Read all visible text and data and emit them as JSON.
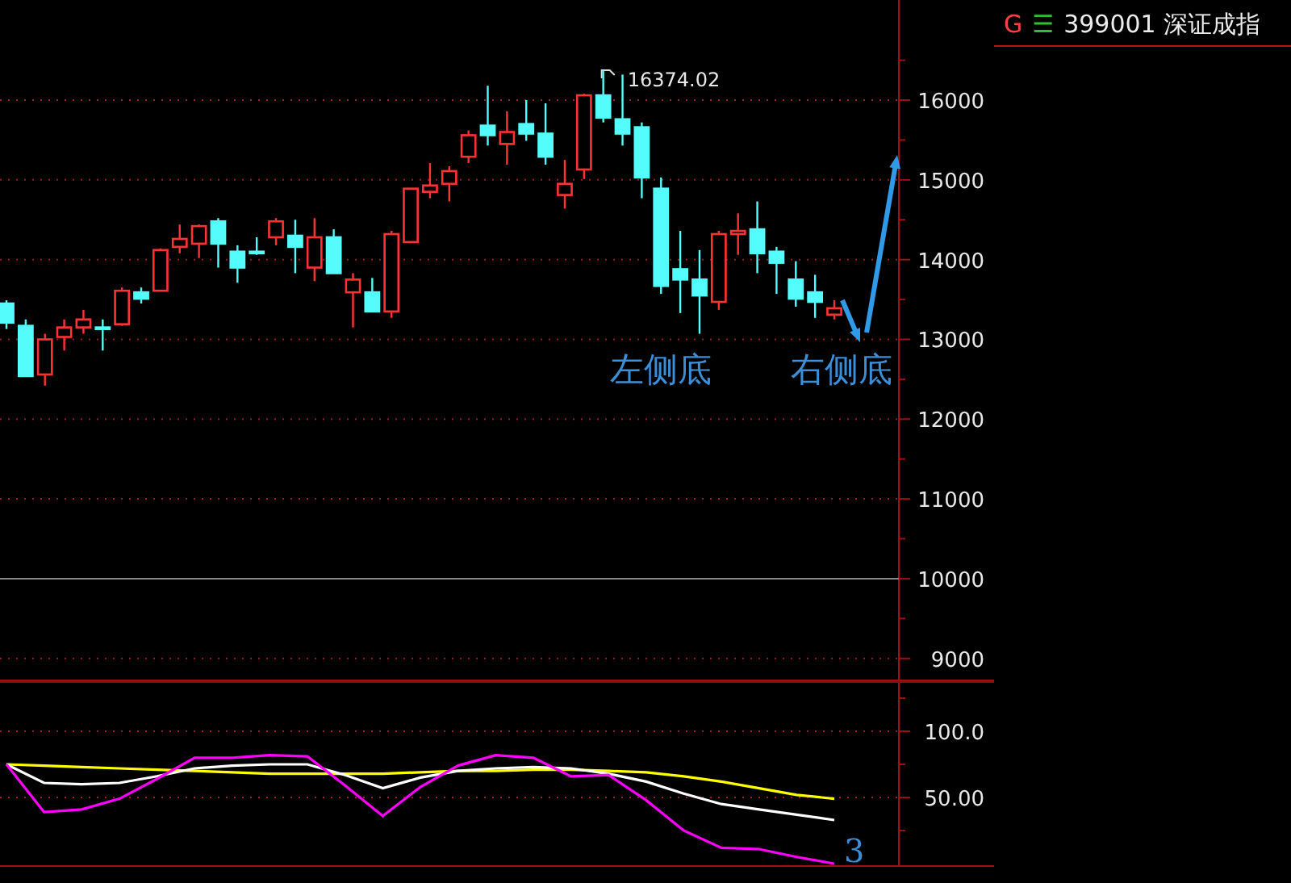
{
  "header": {
    "flag": "G",
    "menu_glyph": "☰",
    "title": "399001 深证成指"
  },
  "price_chart": {
    "chart_data": {
      "type": "candlestick",
      "categories": [
        null,
        null,
        null,
        null,
        null,
        null,
        null,
        null,
        null,
        null,
        null,
        null,
        null,
        null,
        null,
        null,
        null,
        null,
        null,
        null,
        null,
        null,
        null,
        null,
        null,
        null,
        null,
        null,
        null,
        null,
        null,
        null,
        null,
        null,
        null,
        null,
        null,
        null,
        null,
        null,
        null,
        null,
        null,
        null
      ],
      "ylim": [
        8714,
        17255
      ],
      "yticks": [
        9000,
        10000,
        11000,
        12000,
        13000,
        14000,
        15000,
        16000
      ],
      "grid": true,
      "ref_lines": [
        {
          "axis": "y",
          "value": 10000
        }
      ],
      "ohlc": [
        [
          13450,
          13490,
          13130,
          13210
        ],
        [
          13170,
          13250,
          12540,
          12540
        ],
        [
          12560,
          13070,
          12420,
          13000
        ],
        [
          13030,
          13250,
          12860,
          13150
        ],
        [
          13150,
          13370,
          13070,
          13250
        ],
        [
          13150,
          13250,
          12860,
          13130
        ],
        [
          13190,
          13650,
          13170,
          13610
        ],
        [
          13590,
          13650,
          13450,
          13510
        ],
        [
          13610,
          14140,
          13610,
          14120
        ],
        [
          14160,
          14440,
          14080,
          14260
        ],
        [
          14200,
          14440,
          14020,
          14420
        ],
        [
          14480,
          14520,
          13900,
          14200
        ],
        [
          14100,
          14180,
          13710,
          13900
        ],
        [
          14100,
          14280,
          14060,
          14080
        ],
        [
          14280,
          14520,
          14180,
          14480
        ],
        [
          14300,
          14500,
          13830,
          14160
        ],
        [
          13900,
          14520,
          13730,
          14280
        ],
        [
          14280,
          14380,
          13830,
          13830
        ],
        [
          13590,
          13830,
          13150,
          13750
        ],
        [
          13590,
          13770,
          13350,
          13350
        ],
        [
          13350,
          14360,
          13270,
          14320
        ],
        [
          14220,
          14890,
          14220,
          14890
        ],
        [
          14850,
          15210,
          14770,
          14930
        ],
        [
          14950,
          15170,
          14730,
          15110
        ],
        [
          15290,
          15620,
          15210,
          15560
        ],
        [
          15680,
          16180,
          15430,
          15560
        ],
        [
          15450,
          15860,
          15190,
          15600
        ],
        [
          15700,
          16000,
          15490,
          15580
        ],
        [
          15580,
          15960,
          15190,
          15290
        ],
        [
          14810,
          15250,
          14640,
          14950
        ],
        [
          15130,
          16080,
          15010,
          16060
        ],
        [
          16060,
          16374,
          15720,
          15780
        ],
        [
          15760,
          16320,
          15430,
          15580
        ],
        [
          15660,
          15720,
          14770,
          15030
        ],
        [
          14890,
          15030,
          13570,
          13670
        ],
        [
          13880,
          14360,
          13330,
          13750
        ],
        [
          13750,
          14120,
          13070,
          13550
        ],
        [
          13470,
          14360,
          13370,
          14320
        ],
        [
          14320,
          14580,
          14060,
          14360
        ],
        [
          14380,
          14730,
          13830,
          14080
        ],
        [
          14100,
          14160,
          13570,
          13960
        ],
        [
          13750,
          13980,
          13410,
          13510
        ],
        [
          13590,
          13810,
          13270,
          13470
        ],
        [
          13310,
          13490,
          13250,
          13390
        ]
      ],
      "annotations": [
        "16374.02",
        "左侧底",
        "右侧底"
      ]
    }
  },
  "indicator_chart": {
    "chart_data": {
      "type": "line",
      "categories": [
        null,
        null,
        null,
        null,
        null,
        null,
        null,
        null,
        null,
        null,
        null,
        null,
        null,
        null,
        null,
        null,
        null,
        null,
        null,
        null,
        null,
        null,
        null
      ],
      "ylim": [
        -2.4,
        137.8
      ],
      "grid": true,
      "yticks": [
        {
          "value": 50,
          "label": "50.00"
        },
        {
          "value": 100,
          "label": "100.0"
        }
      ],
      "series": [
        {
          "color": "#ffff00",
          "values": [
            75,
            74,
            73,
            72,
            71,
            70,
            69,
            68,
            68,
            68,
            68,
            69,
            70,
            70,
            71,
            71,
            70,
            69,
            66,
            62,
            57,
            52,
            49
          ]
        },
        {
          "color": "#ffffff",
          "values": [
            75,
            61,
            60,
            61,
            66,
            72,
            74,
            75,
            75,
            67,
            57,
            65,
            70,
            72,
            73,
            72,
            68,
            62,
            53,
            45,
            41,
            37,
            33
          ]
        },
        {
          "color": "#ff00ff",
          "values": [
            75,
            39,
            41,
            49,
            64,
            80,
            80,
            82,
            81,
            59,
            36,
            58,
            74,
            82,
            80,
            66,
            67,
            48,
            25,
            12,
            11,
            5,
            0
          ]
        }
      ],
      "annotations": [
        "3"
      ]
    }
  }
}
